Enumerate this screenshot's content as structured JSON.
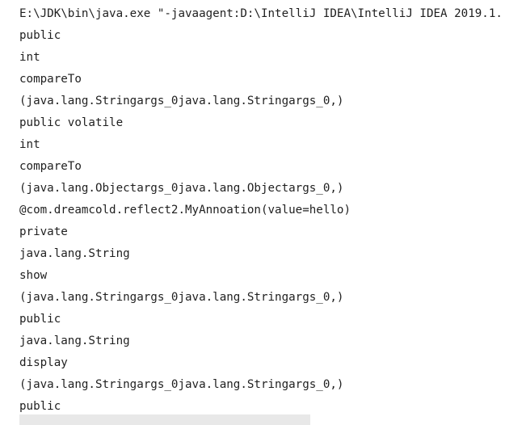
{
  "console": {
    "command": "E:\\JDK\\bin\\java.exe \"-javaagent:D:\\IntelliJ IDEA\\IntelliJ IDEA 2019.1.",
    "lines": [
      "public",
      "int",
      "compareTo",
      "(java.lang.Stringargs_0java.lang.Stringargs_0,)",
      "public volatile",
      "int",
      "compareTo",
      "(java.lang.Objectargs_0java.lang.Objectargs_0,)",
      "@com.dreamcold.reflect2.MyAnnoation(value=hello)",
      "private",
      "java.lang.String",
      "show",
      "(java.lang.Stringargs_0java.lang.Stringargs_0,)",
      "public",
      "java.lang.String",
      "display",
      "(java.lang.Stringargs_0java.lang.Stringargs_0,)",
      "public"
    ]
  }
}
